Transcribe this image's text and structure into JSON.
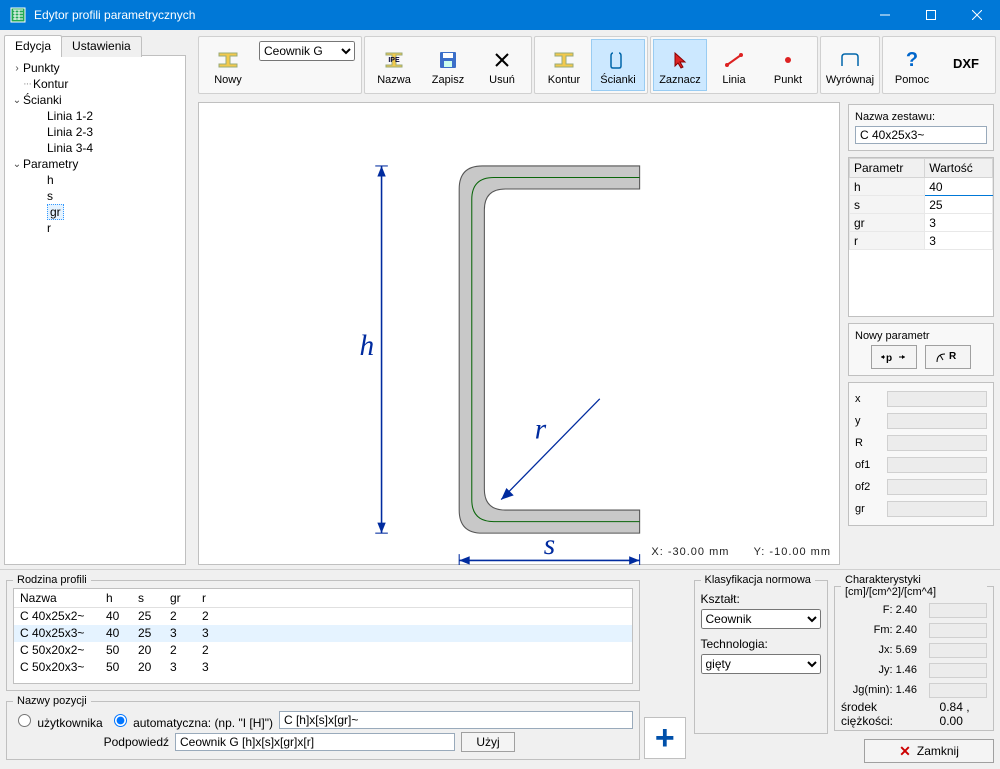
{
  "window": {
    "title": "Edytor profili parametrycznych"
  },
  "tabs": {
    "edit": "Edycja",
    "settings": "Ustawienia"
  },
  "tree": {
    "points": "Punkty",
    "contour": "Kontur",
    "walls": "Ścianki",
    "line12": "Linia 1-2",
    "line23": "Linia 2-3",
    "line34": "Linia 3-4",
    "params": "Parametry",
    "p_h": "h",
    "p_s": "s",
    "p_gr": "gr",
    "p_r": "r"
  },
  "toolbar": {
    "new": "Nowy",
    "profile_select": "Ceownik G",
    "name": "Nazwa",
    "save": "Zapisz",
    "delete": "Usuń",
    "contour": "Kontur",
    "walls": "Ścianki",
    "select": "Zaznacz",
    "line": "Linia",
    "point": "Punkt",
    "align": "Wyrównaj",
    "help": "Pomoc",
    "dxf": "DXF"
  },
  "drawing": {
    "h": "h",
    "s": "s",
    "r": "r",
    "status_x_label": "X:",
    "status_x": "-30.00 mm",
    "status_y_label": "Y:",
    "status_y": "-10.00 mm"
  },
  "right": {
    "set_label": "Nazwa zestawu:",
    "set_value": "C 40x25x3~",
    "param_hdr": "Parametr",
    "value_hdr": "Wartość",
    "rows": [
      {
        "p": "h",
        "v": "40"
      },
      {
        "p": "s",
        "v": "25"
      },
      {
        "p": "gr",
        "v": "3"
      },
      {
        "p": "r",
        "v": "3"
      }
    ],
    "newparam": "Nowy parametr",
    "geo": {
      "x": "x",
      "y": "y",
      "R": "R",
      "of1": "of1",
      "of2": "of2",
      "gr": "gr"
    }
  },
  "family": {
    "legend": "Rodzina profili",
    "cols": {
      "name": "Nazwa",
      "h": "h",
      "s": "s",
      "gr": "gr",
      "r": "r"
    },
    "rows": [
      {
        "n": "C 40x25x2~",
        "h": "40",
        "s": "25",
        "gr": "2",
        "r": "2"
      },
      {
        "n": "C 40x25x3~",
        "h": "40",
        "s": "25",
        "gr": "3",
        "r": "3"
      },
      {
        "n": "C 50x20x2~",
        "h": "50",
        "s": "20",
        "gr": "2",
        "r": "2"
      },
      {
        "n": "C 50x20x3~",
        "h": "50",
        "s": "20",
        "gr": "3",
        "r": "3"
      }
    ]
  },
  "posnames": {
    "legend": "Nazwy pozycji",
    "user": "użytkownika",
    "auto": "automatyczna: (np. \"I [H]\")",
    "auto_val": "C [h]x[s]x[gr]~",
    "hint_label": "Podpowiedź",
    "hint_val": "Ceownik G [h]x[s]x[gr]x[r]",
    "use": "Użyj"
  },
  "classify": {
    "legend": "Klasyfikacja normowa",
    "shape_label": "Kształt:",
    "shape_val": "Ceownik",
    "tech_label": "Technologia:",
    "tech_val": "gięty"
  },
  "chars": {
    "legend": "Charakterystyki [cm]/[cm^2]/[cm^4]",
    "F": "F: 2.40",
    "Fm": "Fm: 2.40",
    "Jx": "Jx: 5.69",
    "Jy": "Jy: 1.46",
    "Jg": "Jg(min): 1.46",
    "cg_label": "środek ciężkości:",
    "cg_val": "0.84 , 0.00",
    "close": "Zamknij"
  }
}
